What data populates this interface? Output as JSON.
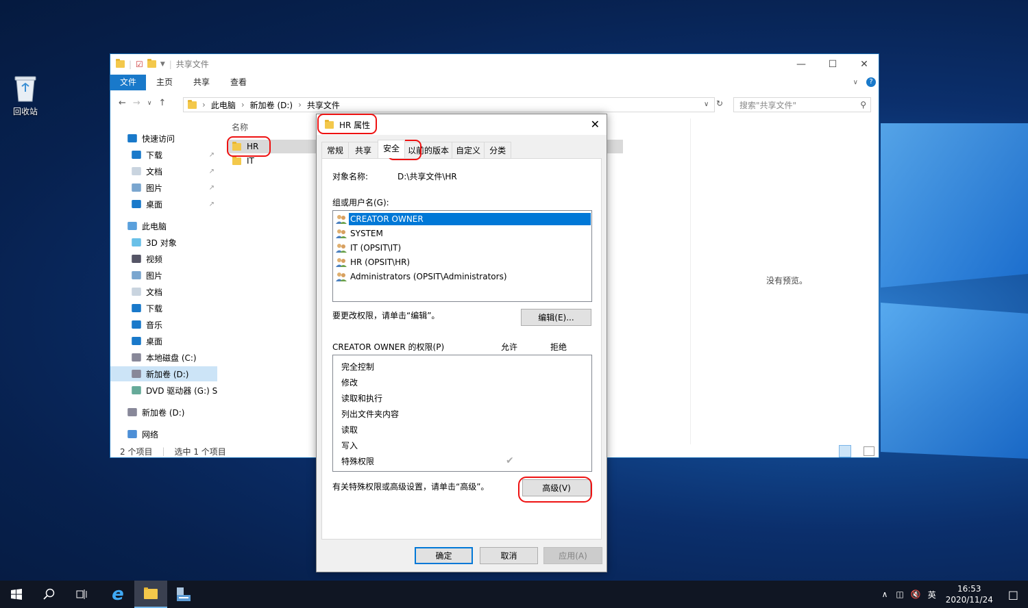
{
  "desktop": {
    "recycle_bin_label": "回收站"
  },
  "explorer": {
    "title": "共享文件",
    "ribbon_tabs": [
      "文件",
      "主页",
      "共享",
      "查看"
    ],
    "address_parts": [
      "此电脑",
      "新加卷 (D:)",
      "共享文件"
    ],
    "search_placeholder": "搜索\"共享文件\"",
    "column_name": "名称",
    "files": [
      {
        "name": "HR",
        "selected": true
      },
      {
        "name": "IT",
        "selected": false
      }
    ],
    "sidebar": [
      {
        "label": "快速访问",
        "icon": "star-icon",
        "pinned": false,
        "indent": 0
      },
      {
        "label": "下载",
        "icon": "download-icon",
        "pinned": true,
        "indent": 1
      },
      {
        "label": "文档",
        "icon": "document-icon",
        "pinned": true,
        "indent": 1
      },
      {
        "label": "图片",
        "icon": "pictures-icon",
        "pinned": true,
        "indent": 1
      },
      {
        "label": "桌面",
        "icon": "desktop-icon",
        "pinned": true,
        "indent": 1
      },
      {
        "label": "此电脑",
        "icon": "computer-icon",
        "pinned": false,
        "indent": 0
      },
      {
        "label": "3D 对象",
        "icon": "3d-objects-icon",
        "pinned": false,
        "indent": 1
      },
      {
        "label": "视频",
        "icon": "video-icon",
        "pinned": false,
        "indent": 1
      },
      {
        "label": "图片",
        "icon": "pictures-icon",
        "pinned": false,
        "indent": 1
      },
      {
        "label": "文档",
        "icon": "document-icon",
        "pinned": false,
        "indent": 1
      },
      {
        "label": "下载",
        "icon": "download-icon",
        "pinned": false,
        "indent": 1
      },
      {
        "label": "音乐",
        "icon": "music-icon",
        "pinned": false,
        "indent": 1
      },
      {
        "label": "桌面",
        "icon": "desktop-icon",
        "pinned": false,
        "indent": 1
      },
      {
        "label": "本地磁盘 (C:)",
        "icon": "drive-icon",
        "pinned": false,
        "indent": 1
      },
      {
        "label": "新加卷 (D:)",
        "icon": "drive-icon",
        "pinned": false,
        "indent": 1,
        "selected": true
      },
      {
        "label": "DVD 驱动器 (G:) S",
        "icon": "dvd-icon",
        "pinned": false,
        "indent": 1
      },
      {
        "label": "新加卷 (D:)",
        "icon": "drive-icon",
        "pinned": false,
        "indent": 0
      },
      {
        "label": "网络",
        "icon": "network-icon",
        "pinned": false,
        "indent": 0
      }
    ],
    "preview_text": "没有预览。",
    "status_count": "2 个项目",
    "status_selected": "选中 1 个项目"
  },
  "dialog": {
    "title": "HR 属性",
    "tabs": [
      "常规",
      "共享",
      "安全",
      "以前的版本",
      "自定义",
      "分类"
    ],
    "active_tab": "安全",
    "object_label": "对象名称:",
    "object_value": "D:\\共享文件\\HR",
    "groups_label": "组或用户名(G):",
    "users": [
      {
        "name": "CREATOR OWNER",
        "selected": true
      },
      {
        "name": "SYSTEM",
        "selected": false
      },
      {
        "name": "IT (OPSIT\\IT)",
        "selected": false
      },
      {
        "name": "HR (OPSIT\\HR)",
        "selected": false
      },
      {
        "name": "Administrators (OPSIT\\Administrators)",
        "selected": false
      }
    ],
    "change_hint": "要更改权限，请单击“编辑”。",
    "edit_button": "编辑(E)...",
    "perm_header": "CREATOR OWNER 的权限(P)",
    "allow_label": "允许",
    "deny_label": "拒绝",
    "permissions": [
      {
        "name": "完全控制",
        "allow": false
      },
      {
        "name": "修改",
        "allow": false
      },
      {
        "name": "读取和执行",
        "allow": false
      },
      {
        "name": "列出文件夹内容",
        "allow": false
      },
      {
        "name": "读取",
        "allow": false
      },
      {
        "name": "写入",
        "allow": false
      },
      {
        "name": "特殊权限",
        "allow": true
      }
    ],
    "advanced_hint": "有关特殊权限或高级设置，请单击“高级”。",
    "advanced_button": "高级(V)",
    "ok_button": "确定",
    "cancel_button": "取消",
    "apply_button": "应用(A)"
  },
  "taskbar": {
    "time": "16:53",
    "date": "2020/11/24",
    "ime": "英"
  },
  "colors": {
    "accent": "#0078d7",
    "highlight_ring": "#e11111",
    "taskbar": "#101623"
  }
}
